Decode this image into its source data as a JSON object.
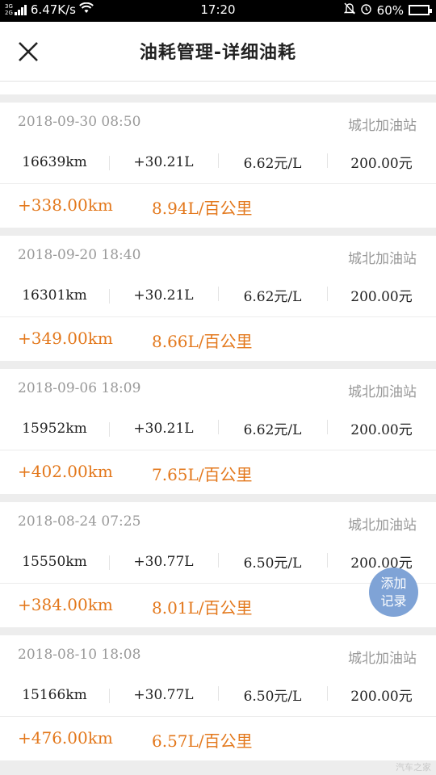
{
  "status_bar": {
    "network_top": "3G",
    "network_bottom": "2G",
    "speed": "6.47K/s",
    "time": "17:20",
    "battery_percent": "60%",
    "battery_level": 0.6
  },
  "nav": {
    "title": "油耗管理-详细油耗",
    "close_icon": "close-icon"
  },
  "records": [
    {
      "datetime": "2018-09-30 08:50",
      "station": "城北加油站",
      "odometer": "16639km",
      "volume": "+30.21L",
      "price": "6.62元/L",
      "amount": "200.00元",
      "distance": "+338.00km",
      "consumption": "8.94L/百公里"
    },
    {
      "datetime": "2018-09-20 18:40",
      "station": "城北加油站",
      "odometer": "16301km",
      "volume": "+30.21L",
      "price": "6.62元/L",
      "amount": "200.00元",
      "distance": "+349.00km",
      "consumption": "8.66L/百公里"
    },
    {
      "datetime": "2018-09-06 18:09",
      "station": "城北加油站",
      "odometer": "15952km",
      "volume": "+30.21L",
      "price": "6.62元/L",
      "amount": "200.00元",
      "distance": "+402.00km",
      "consumption": "7.65L/百公里"
    },
    {
      "datetime": "2018-08-24 07:25",
      "station": "城北加油站",
      "odometer": "15550km",
      "volume": "+30.77L",
      "price": "6.50元/L",
      "amount": "200.00元",
      "distance": "+384.00km",
      "consumption": "8.01L/百公里"
    },
    {
      "datetime": "2018-08-10 18:08",
      "station": "城北加油站",
      "odometer": "15166km",
      "volume": "+30.77L",
      "price": "6.50元/L",
      "amount": "200.00元",
      "distance": "+476.00km",
      "consumption": "6.57L/百公里"
    }
  ],
  "fab": {
    "line1": "添加",
    "line2": "记录"
  },
  "watermark": "汽车之家",
  "colors": {
    "accent": "#e3781c",
    "fab": "#7fa3d6",
    "muted": "#999999"
  }
}
